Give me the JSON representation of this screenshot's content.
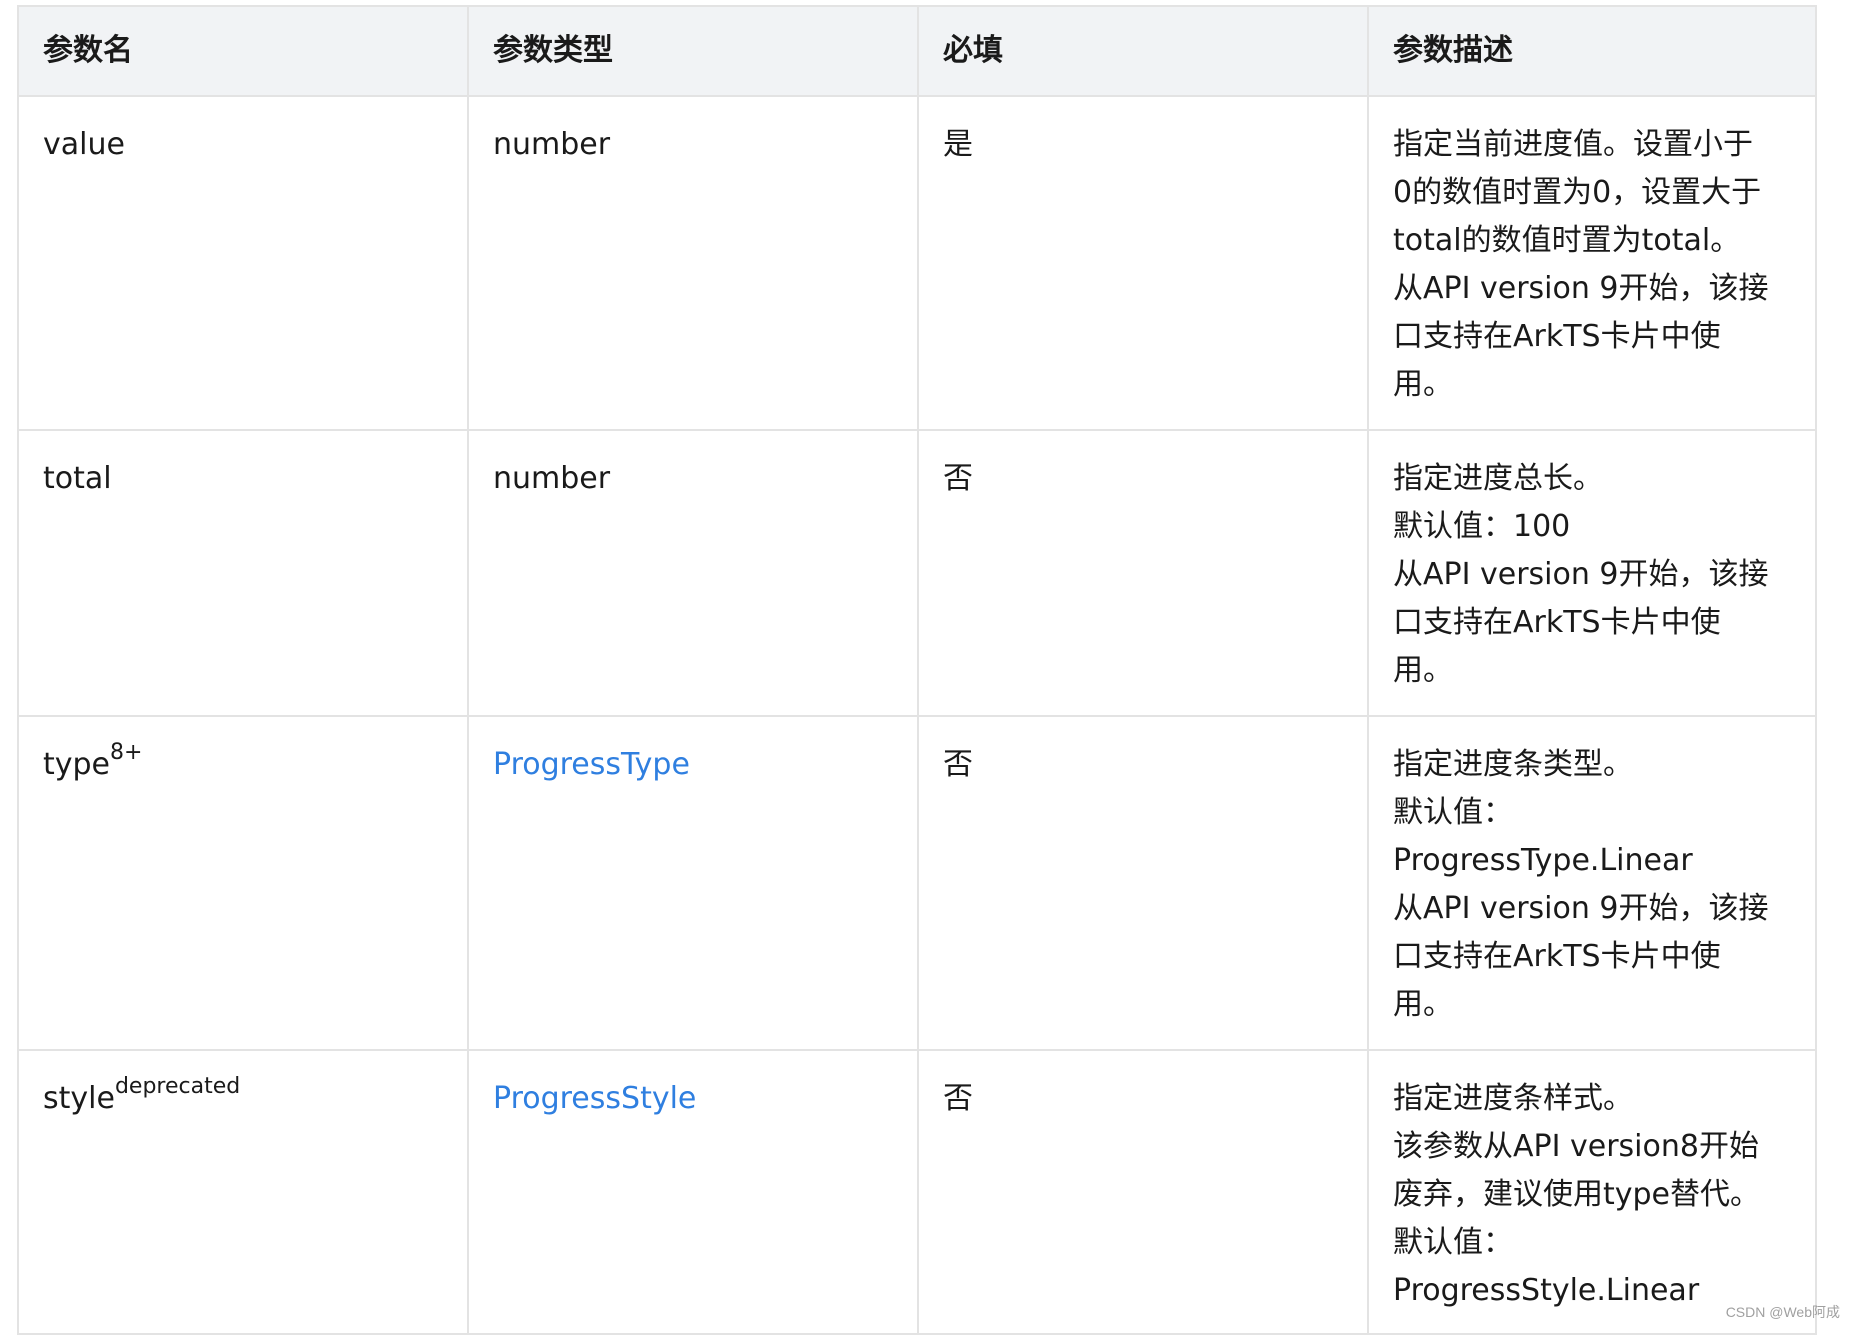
{
  "headers": {
    "name": "参数名",
    "type": "参数类型",
    "required": "必填",
    "description": "参数描述"
  },
  "rows": [
    {
      "name": "value",
      "name_sup": "",
      "type": "number",
      "type_is_link": false,
      "required": "是",
      "description_lines": [
        "指定当前进度值。设置小于",
        "0的数值时置为0，设置大于",
        "total的数值时置为total。",
        "从API version 9开始，该接",
        "口支持在ArkTS卡片中使",
        "用。"
      ]
    },
    {
      "name": "total",
      "name_sup": "",
      "type": "number",
      "type_is_link": false,
      "required": "否",
      "description_lines": [
        "指定进度总长。",
        "默认值：100",
        "从API version 9开始，该接",
        "口支持在ArkTS卡片中使",
        "用。"
      ]
    },
    {
      "name": "type",
      "name_sup": "8+",
      "type": "ProgressType",
      "type_is_link": true,
      "required": "否",
      "description_lines": [
        "指定进度条类型。",
        "默认值：",
        "ProgressType.Linear",
        "从API version 9开始，该接",
        "口支持在ArkTS卡片中使",
        "用。"
      ]
    },
    {
      "name": "style",
      "name_sup": "deprecated",
      "type": "ProgressStyle",
      "type_is_link": true,
      "required": "否",
      "description_lines": [
        "指定进度条样式。",
        "该参数从API version8开始",
        "废弃，建议使用type替代。",
        "默认值：",
        "ProgressStyle.Linear"
      ]
    }
  ],
  "watermark": "CSDN @Web阿成",
  "colors": {
    "link": "#2f7fe0",
    "header_bg": "#f1f3f5",
    "border": "#e3e3e3"
  }
}
